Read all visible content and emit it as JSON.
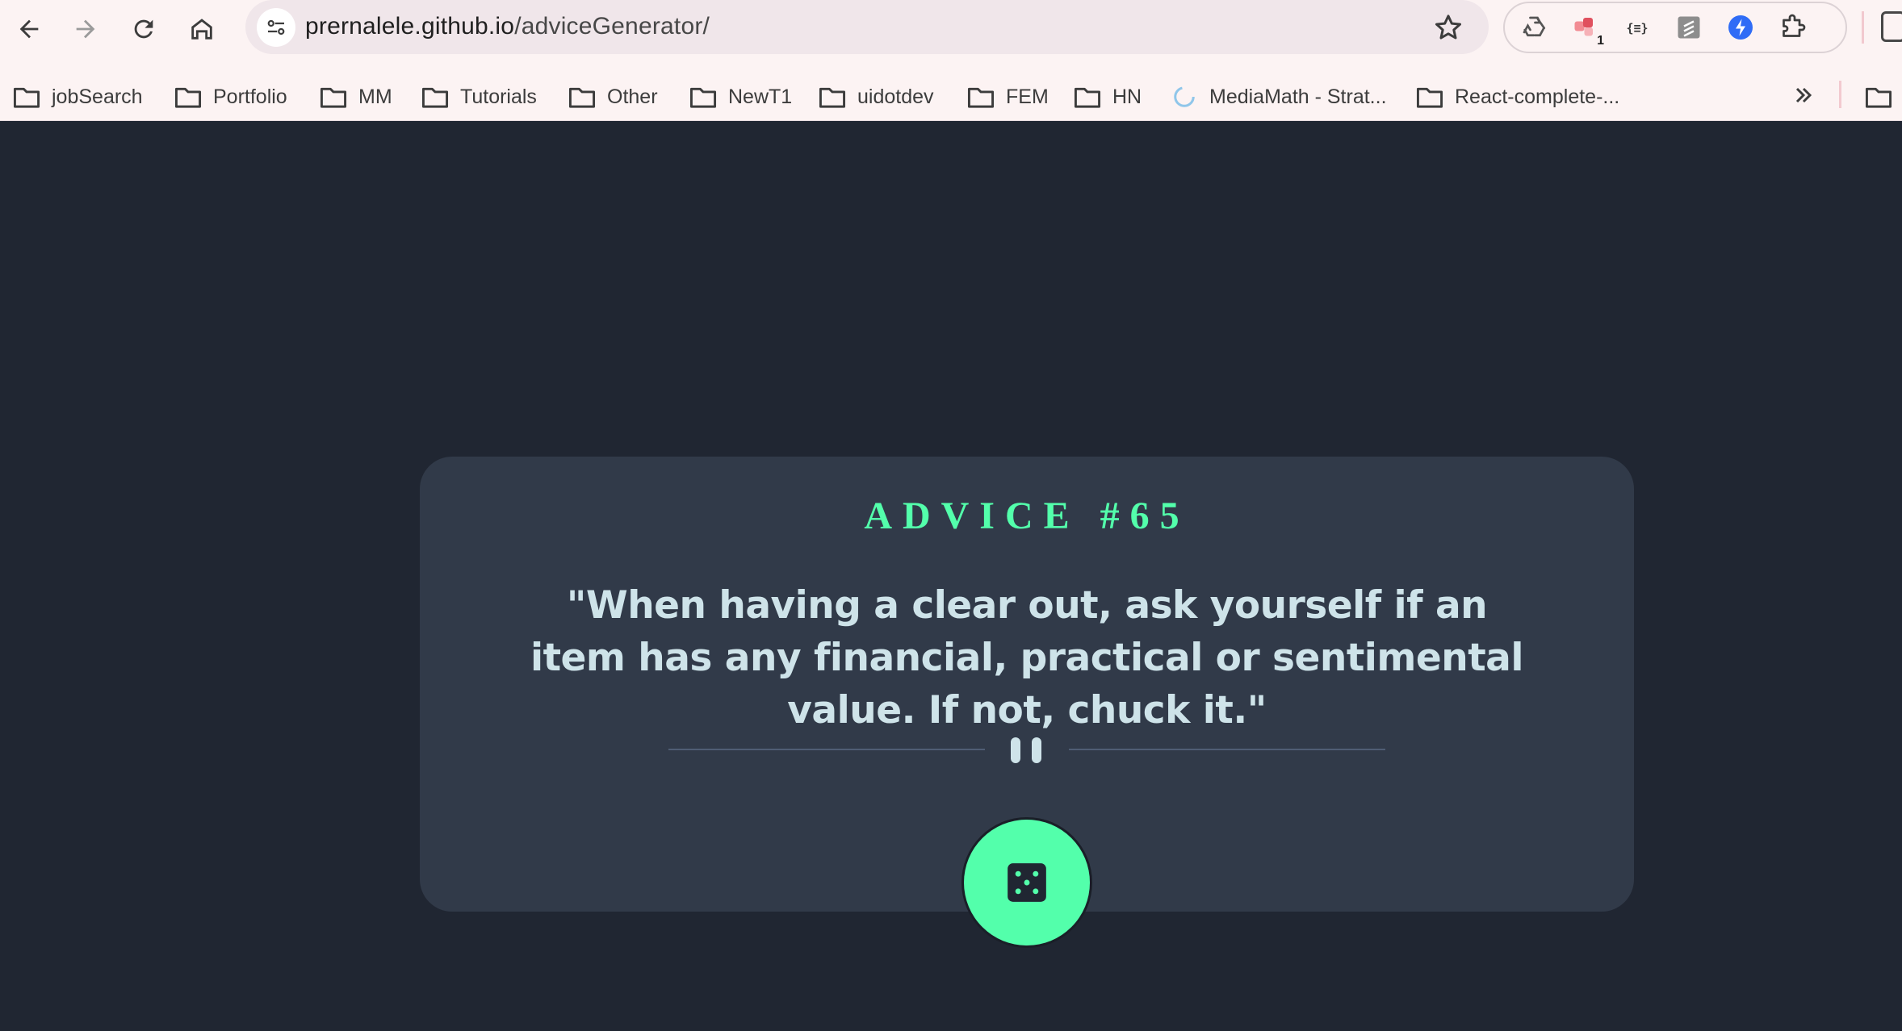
{
  "browser": {
    "url_host": "prernalele.github.io",
    "url_path": "/adviceGenerator/",
    "extension_badge": "1"
  },
  "bookmarks": [
    {
      "label": "jobSearch",
      "icon": "folder-icon"
    },
    {
      "label": "Portfolio",
      "icon": "folder-icon"
    },
    {
      "label": "MM",
      "icon": "folder-icon"
    },
    {
      "label": "Tutorials",
      "icon": "folder-icon"
    },
    {
      "label": "Other",
      "icon": "folder-icon"
    },
    {
      "label": "NewT1",
      "icon": "folder-icon"
    },
    {
      "label": "uidotdev",
      "icon": "folder-icon"
    },
    {
      "label": "FEM",
      "icon": "folder-icon"
    },
    {
      "label": "HN",
      "icon": "folder-icon"
    },
    {
      "label": "MediaMath - Strat...",
      "icon": "loading-spinner-icon"
    },
    {
      "label": "React-complete-...",
      "icon": "folder-icon"
    }
  ],
  "advice": {
    "heading": "ADVICE #65",
    "text": "\"When having a clear out, ask yourself if an item has any financial, practical or sentimental value. If not, chuck it.\""
  },
  "colors": {
    "page_bg": "#202632",
    "card_bg": "#313a49",
    "accent": "#53ffab",
    "text": "#cee3e9"
  }
}
